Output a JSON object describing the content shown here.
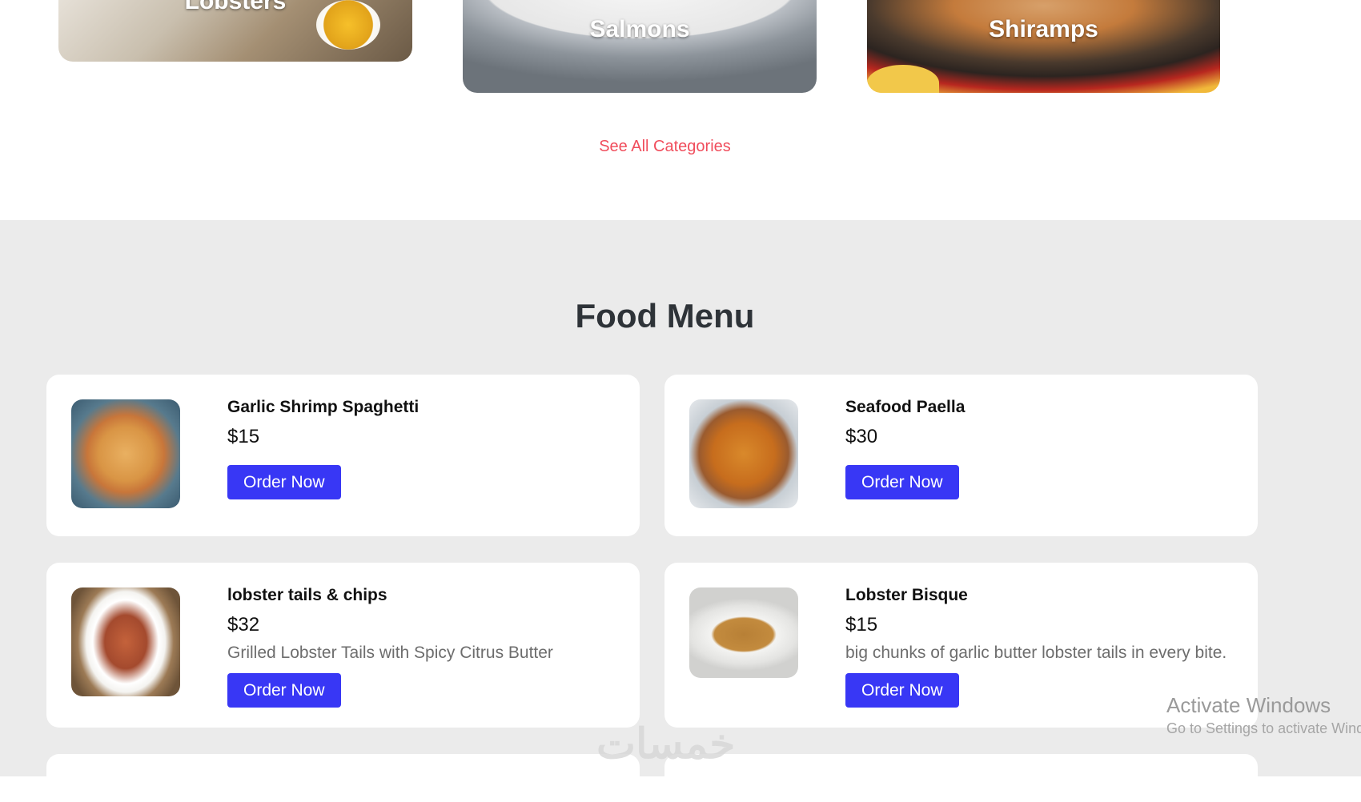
{
  "categories": {
    "items": [
      {
        "label": "Lobsters"
      },
      {
        "label": "Salmons"
      },
      {
        "label": "Shiramps"
      }
    ],
    "see_all": "See All Categories"
  },
  "menu": {
    "title": "Food Menu",
    "order_label": "Order Now",
    "items": [
      {
        "name": "Garlic Shrimp Spaghetti",
        "price": "$15",
        "description": ""
      },
      {
        "name": "Seafood Paella",
        "price": "$30",
        "description": ""
      },
      {
        "name": "lobster tails & chips",
        "price": "$32",
        "description": "Grilled Lobster Tails with Spicy Citrus Butter"
      },
      {
        "name": "Lobster Bisque",
        "price": "$15",
        "description": "big chunks of garlic butter lobster tails in every bite."
      }
    ]
  },
  "overlay": {
    "activate_title": "Activate Windows",
    "activate_sub": "Go to Settings to activate Windows.",
    "logo_text": "خمسات"
  },
  "colors": {
    "accent_button": "#3837f5",
    "link": "#f04d5c",
    "section_bg": "#ebebeb"
  }
}
